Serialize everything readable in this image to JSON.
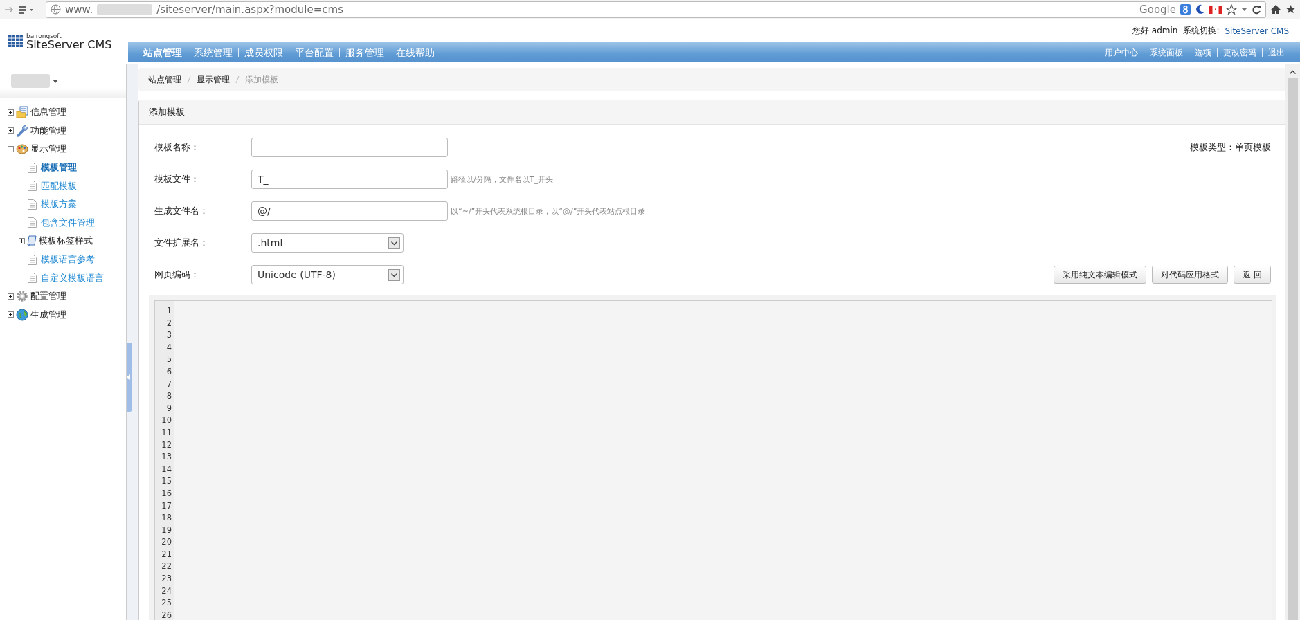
{
  "browser": {
    "url_prefix": "www.",
    "url_path": "/siteserver/main.aspx?module=cms",
    "search_engine": "Google"
  },
  "header": {
    "logo_small": "bairongsoft",
    "logo": "SiteServer CMS",
    "greeting": "您好 admin",
    "switch_label": "系统切换:",
    "switch_link": "SiteServer CMS"
  },
  "nav": [
    {
      "label": "站点管理",
      "selected": true
    },
    {
      "label": "系统管理",
      "selected": false
    },
    {
      "label": "成员权限",
      "selected": false
    },
    {
      "label": "平台配置",
      "selected": false
    },
    {
      "label": "服务管理",
      "selected": false
    },
    {
      "label": "在线帮助",
      "selected": false
    }
  ],
  "user_links": [
    "用户中心",
    "系统面板",
    "选项",
    "更改密码",
    "退出"
  ],
  "sidebar": {
    "items": [
      {
        "label": "信息管理",
        "expanded": false
      },
      {
        "label": "功能管理",
        "expanded": false
      },
      {
        "label": "显示管理",
        "expanded": true,
        "children": [
          {
            "kind": "page",
            "label": "模板管理",
            "selected": true
          },
          {
            "kind": "page",
            "label": "匹配模板",
            "selected": false
          },
          {
            "kind": "page",
            "label": "模版方案",
            "selected": false
          },
          {
            "kind": "page",
            "label": "包含文件管理",
            "selected": false
          },
          {
            "kind": "group",
            "label": "模板标签样式",
            "expanded": false,
            "selected": false
          },
          {
            "kind": "page",
            "label": "模板语言参考",
            "selected": false
          },
          {
            "kind": "page",
            "label": "自定义模板语言",
            "selected": false
          }
        ]
      },
      {
        "label": "配置管理",
        "expanded": false
      },
      {
        "label": "生成管理",
        "expanded": false
      }
    ]
  },
  "breadcrumb": [
    {
      "label": "站点管理",
      "current": false
    },
    {
      "label": "显示管理",
      "current": false
    },
    {
      "label": "添加模板",
      "current": true
    }
  ],
  "panel": {
    "title": "添加模板",
    "template_type": {
      "label": "模板类型：",
      "value": "单页模板"
    },
    "fields": [
      {
        "kind": "text",
        "label": "模板名称："
      },
      {
        "kind": "text",
        "label": "模板文件：",
        "value": "T_",
        "hint": "路径以/分隔，文件名以T_开头"
      },
      {
        "kind": "text",
        "label": "生成文件名：",
        "value": "@/",
        "hint": "以“~/”开头代表系统根目录，以“@/”开头代表站点根目录"
      },
      {
        "kind": "select",
        "label": "文件扩展名：",
        "value": ".html"
      },
      {
        "kind": "select",
        "label": "网页编码：",
        "value": "Unicode (UTF-8)"
      }
    ],
    "buttons": [
      "采用纯文本编辑模式",
      "对代码应用格式",
      "返 回"
    ],
    "editor": {
      "line_numbers": [
        "1",
        "2",
        "3",
        "4",
        "5",
        "6",
        "7",
        "8",
        "9",
        "10",
        "11",
        "12",
        "13",
        "14",
        "15",
        "16",
        "17",
        "18",
        "19",
        "20",
        "21",
        "22",
        "23",
        "24",
        "25",
        "26"
      ]
    }
  }
}
